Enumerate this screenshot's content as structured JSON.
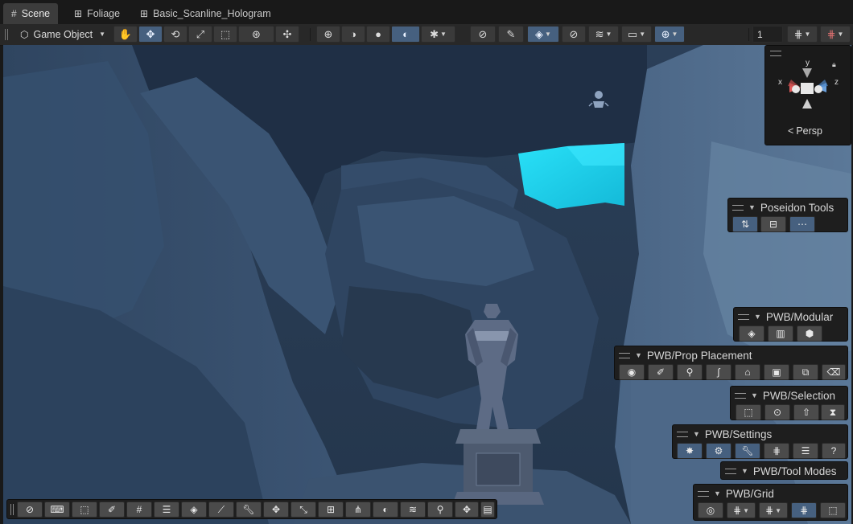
{
  "tabs": [
    {
      "label": "Scene",
      "icon": "grid-icon",
      "active": true
    },
    {
      "label": "Foliage",
      "icon": "prefab-icon",
      "active": false
    },
    {
      "label": "Basic_Scanline_Hologram",
      "icon": "prefab-icon",
      "active": false
    }
  ],
  "toolbar": {
    "object_mode_label": "Game Object",
    "grid_size_value": "1"
  },
  "gizmo": {
    "x_label": "x",
    "y_label": "y",
    "z_label": "z",
    "persp_label": "Persp"
  },
  "overlays": {
    "poseidon_title": "Poseidon Tools",
    "modular_title": "PWB/Modular",
    "prop_title": "PWB/Prop Placement",
    "selection_title": "PWB/Selection",
    "settings_title": "PWB/Settings",
    "toolmodes_title": "PWB/Tool Modes",
    "grid_title": "PWB/Grid"
  },
  "colors": {
    "accent": "#46607f",
    "hologram": "#1fd6f2",
    "scene_base": "#2d4058"
  }
}
